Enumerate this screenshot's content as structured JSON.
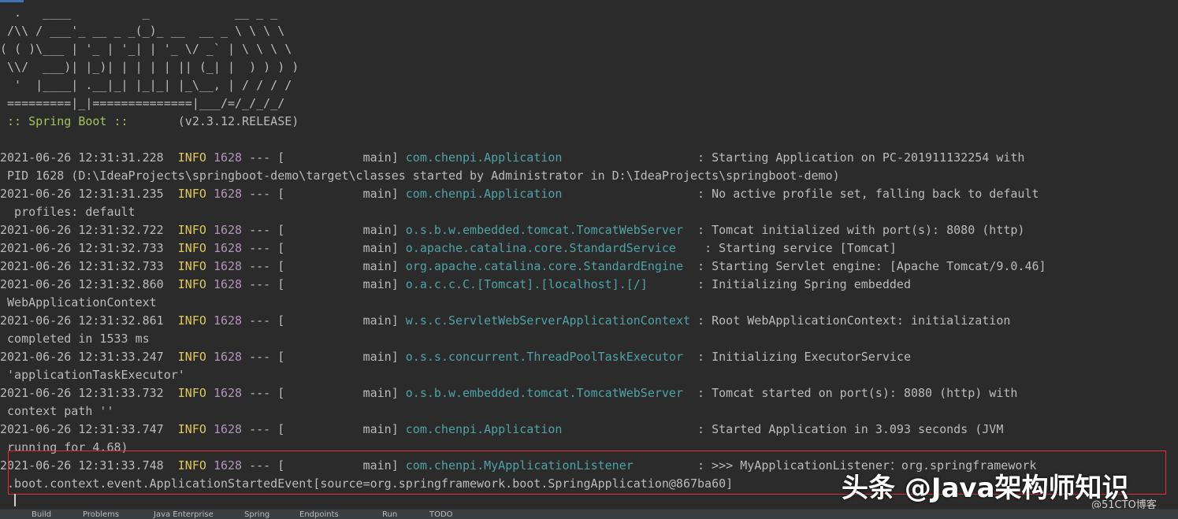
{
  "banner": [
    "  .   ____          _            __ _ _",
    " /\\\\ / ___'_ __ _ _(_)_ __  __ _ \\ \\ \\ \\",
    "( ( )\\___ | '_ | '_| | '_ \\/ _` | \\ \\ \\ \\",
    " \\\\/  ___)| |_)| | | | | || (_| |  ) ) ) )",
    "  '  |____| .__|_| |_|_| |_\\__, | / / / /",
    " =========|_|==============|___/=/_/_/_/"
  ],
  "spring_label": " :: Spring Boot :: ",
  "spring_version": "      (v2.3.12.RELEASE)",
  "logs": [
    {
      "ts": "2021-06-26 12:31:31.228",
      "level": "INFO",
      "pid": "1628",
      "sep": " --- [           main] ",
      "logger": "com.chenpi.Application                  ",
      "msg": " : Starting Application on PC-201911132254 with",
      "cont": " PID 1628 (D:\\IdeaProjects\\springboot-demo\\target\\classes started by Administrator in D:\\IdeaProjects\\springboot-demo)"
    },
    {
      "ts": "2021-06-26 12:31:31.235",
      "level": "INFO",
      "pid": "1628",
      "sep": " --- [           main] ",
      "logger": "com.chenpi.Application                  ",
      "msg": " : No active profile set, falling back to default",
      "cont": "  profiles: default"
    },
    {
      "ts": "2021-06-26 12:31:32.722",
      "level": "INFO",
      "pid": "1628",
      "sep": " --- [           main] ",
      "logger": "o.s.b.w.embedded.tomcat.TomcatWebServer ",
      "msg": " : Tomcat initialized with port(s): 8080 (http)",
      "cont": ""
    },
    {
      "ts": "2021-06-26 12:31:32.733",
      "level": "INFO",
      "pid": "1628",
      "sep": " --- [           main] ",
      "logger": "o.apache.catalina.core.StandardService   ",
      "msg": " : Starting service [Tomcat]",
      "cont": ""
    },
    {
      "ts": "2021-06-26 12:31:32.733",
      "level": "INFO",
      "pid": "1628",
      "sep": " --- [           main] ",
      "logger": "org.apache.catalina.core.StandardEngine ",
      "msg": " : Starting Servlet engine: [Apache Tomcat/9.0.46]",
      "cont": ""
    },
    {
      "ts": "2021-06-26 12:31:32.860",
      "level": "INFO",
      "pid": "1628",
      "sep": " --- [           main] ",
      "logger": "o.a.c.c.C.[Tomcat].[localhost].[/]      ",
      "msg": " : Initializing Spring embedded",
      "cont": " WebApplicationContext"
    },
    {
      "ts": "2021-06-26 12:31:32.861",
      "level": "INFO",
      "pid": "1628",
      "sep": " --- [           main] ",
      "logger": "w.s.c.ServletWebServerApplicationContext",
      "msg": " : Root WebApplicationContext: initialization",
      "cont": " completed in 1533 ms"
    },
    {
      "ts": "2021-06-26 12:31:33.247",
      "level": "INFO",
      "pid": "1628",
      "sep": " --- [           main] ",
      "logger": "o.s.s.concurrent.ThreadPoolTaskExecutor ",
      "msg": " : Initializing ExecutorService",
      "cont": " 'applicationTaskExecutor'"
    },
    {
      "ts": "2021-06-26 12:31:33.732",
      "level": "INFO",
      "pid": "1628",
      "sep": " --- [           main] ",
      "logger": "o.s.b.w.embedded.tomcat.TomcatWebServer ",
      "msg": " : Tomcat started on port(s): 8080 (http) with",
      "cont": " context path ''"
    },
    {
      "ts": "2021-06-26 12:31:33.747",
      "level": "INFO",
      "pid": "1628",
      "sep": " --- [           main] ",
      "logger": "com.chenpi.Application                  ",
      "msg": " : Started Application in 3.093 seconds (JVM",
      "cont": " running for 4.68)"
    },
    {
      "ts": "2021-06-26 12:31:33.748",
      "level": "INFO",
      "pid": "1628",
      "sep": " --- [           main] ",
      "logger": "com.chenpi.MyApplicationListener        ",
      "msg": " : >>> MyApplicationListener：org.springframework",
      "cont": " .boot.context.event.ApplicationStartedEvent[source=org.springframework.boot.SpringApplication@867ba60]"
    }
  ],
  "watermark": "头条 @Java架构师知识",
  "watermark_small": "@51CTO博客",
  "bottom_tabs": [
    "Build",
    "Problems",
    "Java Enterprise",
    "Spring",
    "Endpoints",
    "Run",
    "TODO"
  ],
  "colors": {
    "background": "#2b2b2b",
    "info": "#e0c95b",
    "logger": "#4fa3a5",
    "highlight": "#e03030"
  }
}
